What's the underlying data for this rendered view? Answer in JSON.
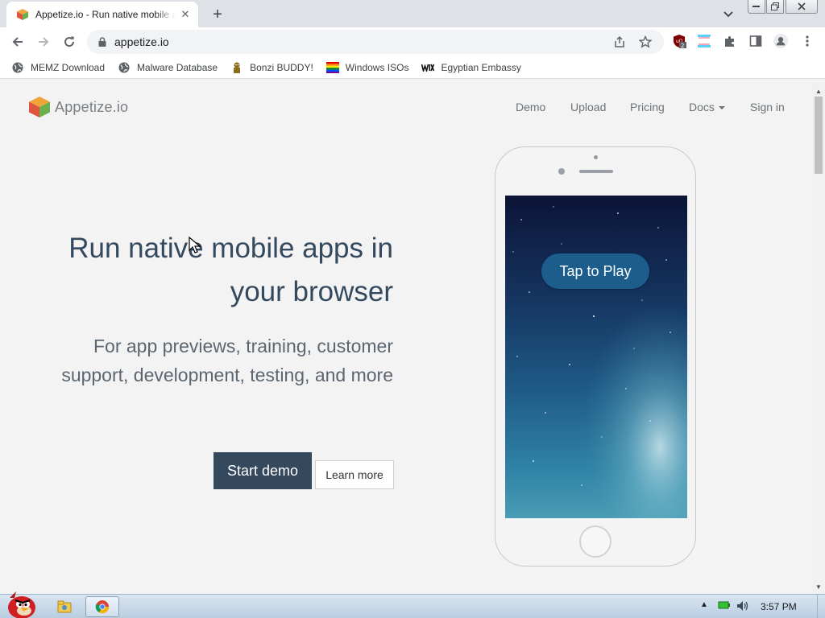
{
  "browser": {
    "tab": {
      "title": "Appetize.io - Run native mobile apps in your browser",
      "close": "✕"
    },
    "new_tab": "+",
    "url": "appetize.io",
    "extension_badge": "2"
  },
  "bookmarks": [
    {
      "label": "MEMZ Download",
      "icon": "globe-icon"
    },
    {
      "label": "Malware Database",
      "icon": "globe-icon"
    },
    {
      "label": "Bonzi BUDDY!",
      "icon": "bonzi-icon"
    },
    {
      "label": "Windows ISOs",
      "icon": "rainbow-flag-icon"
    },
    {
      "label": "Egyptian Embassy",
      "icon": "wix-icon"
    }
  ],
  "site": {
    "brand": "Appetize.io",
    "nav": {
      "demo": "Demo",
      "upload": "Upload",
      "pricing": "Pricing",
      "docs": "Docs",
      "signin": "Sign in"
    },
    "hero": {
      "headline_line1": "Run native mobile apps in",
      "headline_line2": "your browser",
      "subline_line1": "For app previews, training, customer",
      "subline_line2": "support, development, testing, and more",
      "start_demo": "Start demo",
      "learn_more": "Learn more"
    },
    "phone": {
      "tap_to_play": "Tap to Play"
    }
  },
  "taskbar": {
    "clock": "3:57 PM"
  },
  "colors": {
    "primary": "#34495e",
    "tap_button": "#1c5d8c",
    "accent_blue": "#1a73e8"
  }
}
